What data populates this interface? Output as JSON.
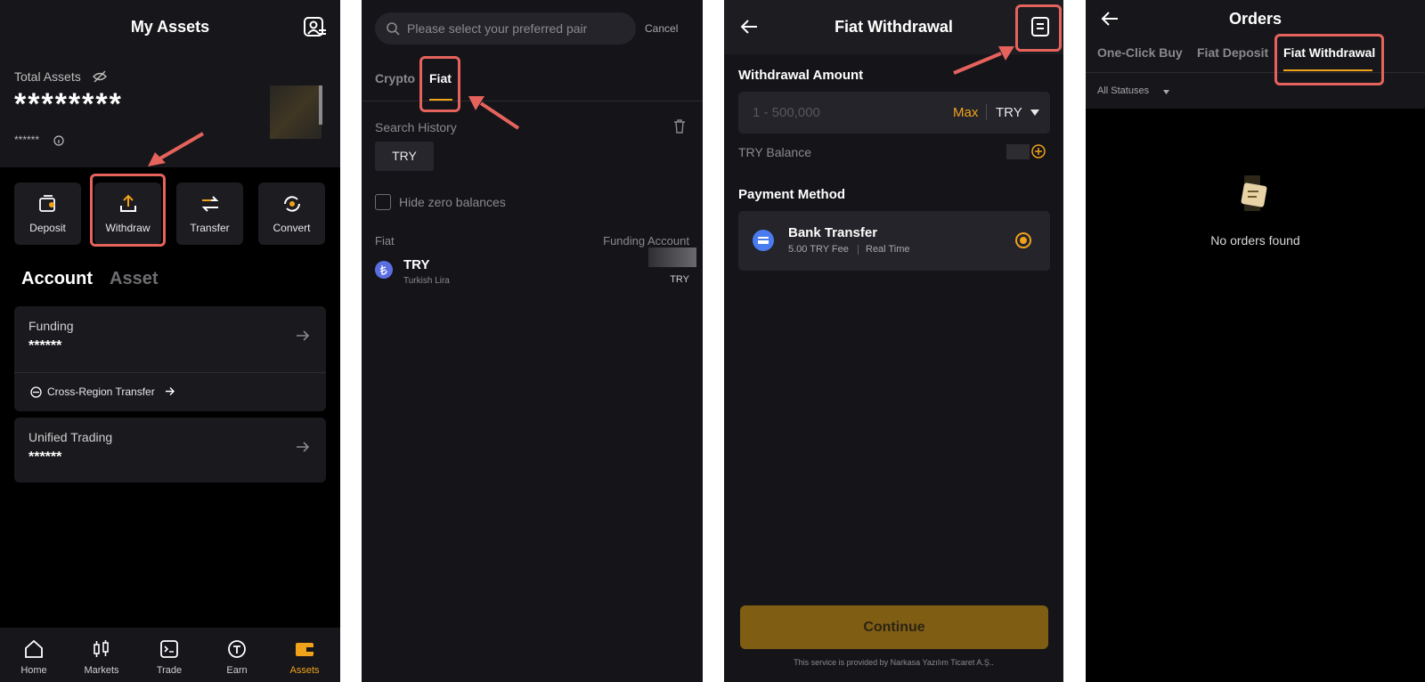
{
  "assets_screen": {
    "title": "My Assets",
    "total_label": "Total Assets",
    "total_value": "********",
    "sub_value": "******",
    "actions": [
      {
        "label": "Deposit",
        "icon": "deposit-icon"
      },
      {
        "label": "Withdraw",
        "icon": "upload-icon"
      },
      {
        "label": "Transfer",
        "icon": "transfer-icon"
      },
      {
        "label": "Convert",
        "icon": "convert-icon"
      }
    ],
    "tabs": [
      "Account",
      "Asset"
    ],
    "funding": {
      "label": "Funding",
      "value": "******",
      "link": "Cross-Region Transfer"
    },
    "unified": {
      "label": "Unified Trading",
      "value": "******"
    },
    "nav": [
      {
        "label": "Home",
        "icon": "home-icon"
      },
      {
        "label": "Markets",
        "icon": "candlestick-icon"
      },
      {
        "label": "Trade",
        "icon": "trade-icon"
      },
      {
        "label": "Earn",
        "icon": "earn-icon"
      },
      {
        "label": "Assets",
        "icon": "wallet-icon"
      }
    ]
  },
  "select_screen": {
    "search_placeholder": "Please select your preferred pair",
    "cancel": "Cancel",
    "tabs": [
      "Crypto",
      "Fiat"
    ],
    "history_label": "Search History",
    "history_chip": "TRY",
    "hide_zero": "Hide zero balances",
    "col_left": "Fiat",
    "col_right": "Funding Account",
    "row": {
      "code": "TRY",
      "name": "Turkish Lira",
      "right_code": "TRY"
    }
  },
  "withdraw_screen": {
    "title": "Fiat Withdrawal",
    "amount_label": "Withdrawal Amount",
    "amount_placeholder": "1 - 500,000",
    "max": "Max",
    "currency": "TRY",
    "balance_label": "TRY Balance",
    "payment_label": "Payment Method",
    "method_name": "Bank Transfer",
    "method_fee": "5.00 TRY Fee",
    "method_speed": "Real Time",
    "continue": "Continue",
    "footer": "This service is provided by Narkasa Yazılım Ticaret A.Ş.."
  },
  "orders_screen": {
    "title": "Orders",
    "tabs": [
      "One-Click Buy",
      "Fiat Deposit",
      "Fiat Withdrawal"
    ],
    "filter": "All Statuses",
    "empty": "No orders found"
  },
  "colors": {
    "accent": "#f0a21a",
    "highlight": "#e5635c",
    "bg": "#141419"
  }
}
